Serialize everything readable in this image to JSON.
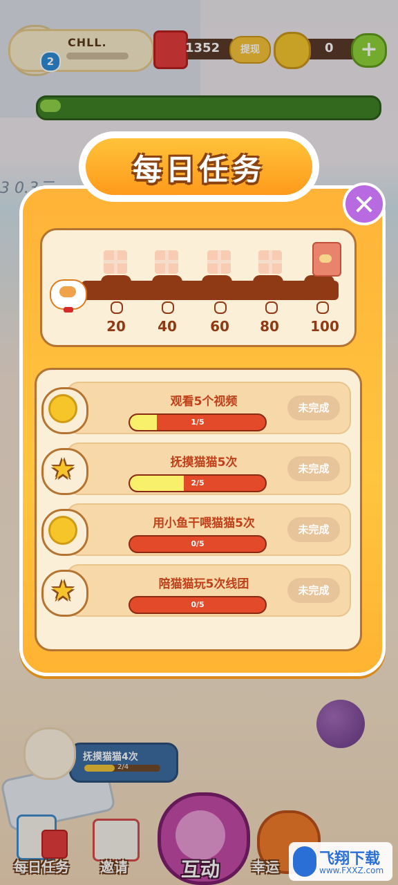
{
  "hud": {
    "player_name": "CHLL.",
    "level": "2",
    "redpack_count": "1352",
    "withdraw_label": "提现",
    "coin_count": "0",
    "add_label": "+"
  },
  "background": {
    "reward_text": "3 0.3元",
    "cat_task_label": "抚摸猫猫4次",
    "cat_task_progress": 0.4,
    "cat_task_count": "2/4"
  },
  "modal": {
    "title": "每日任务",
    "close_label": "✕",
    "milestones": [
      "20",
      "40",
      "60",
      "80",
      "100"
    ],
    "tasks": [
      {
        "title": "观看5个视频",
        "icon": "coin-icon",
        "progress_text": "1/5",
        "progress": 0.2,
        "status": "未完成"
      },
      {
        "title": "抚摸猫猫5次",
        "icon": "star-icon",
        "progress_text": "2/5",
        "progress": 0.4,
        "status": "未完成"
      },
      {
        "title": "用小鱼干喂猫猫5次",
        "icon": "coin-icon",
        "progress_text": "0/5",
        "progress": 0.0,
        "status": "未完成"
      },
      {
        "title": "陪猫猫玩5次线团",
        "icon": "star-icon",
        "progress_text": "0/5",
        "progress": 0.0,
        "status": "未完成"
      }
    ]
  },
  "nav": {
    "daily_label": "每日任务",
    "invite_label": "邀请",
    "interact_label": "互动",
    "lucky_label": "幸运"
  },
  "watermark": {
    "text": "飞翔下载",
    "url": "www.FXXZ.com"
  }
}
